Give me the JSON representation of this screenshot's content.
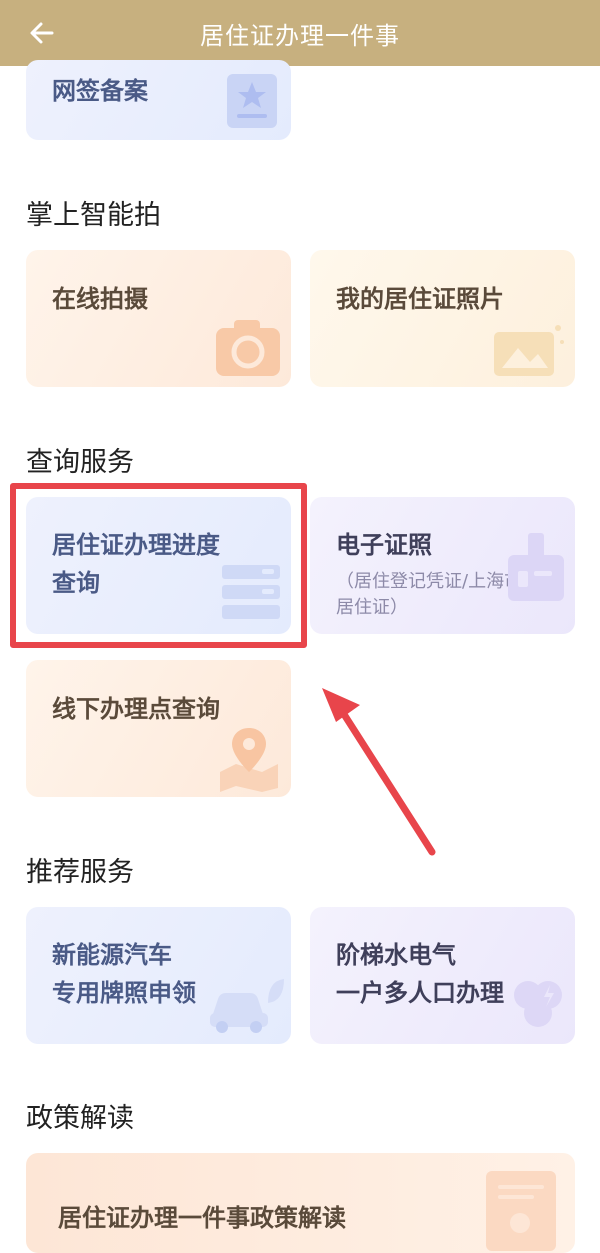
{
  "header": {
    "back_label": "←",
    "title": "居住证办理一件事"
  },
  "cards": {
    "online_sign": "网签备案",
    "online_shoot": "在线拍摄",
    "my_photo": "我的居住证照片",
    "progress_query": "居住证办理进度查询",
    "progress_query_line1": "居住证办理进度",
    "progress_query_line2": "查询",
    "e_license": "电子证照",
    "e_license_sub_line1": "（居住登记凭证/上海市",
    "e_license_sub_line2": "居住证）",
    "offline_points": "线下办理点查询",
    "nev_line1": "新能源汽车",
    "nev_line2": "专用牌照申领",
    "utility_line1": "阶梯水电气",
    "utility_line2": "一户多人口办理",
    "policy": "居住证办理一件事政策解读"
  },
  "sections": {
    "smart_photo": "掌上智能拍",
    "query_service": "查询服务",
    "recommend_service": "推荐服务",
    "policy_interpret": "政策解读"
  },
  "colors": {
    "header_bg": "#c7b07f",
    "highlight_border": "#e8454b",
    "arrow": "#e8454b"
  }
}
